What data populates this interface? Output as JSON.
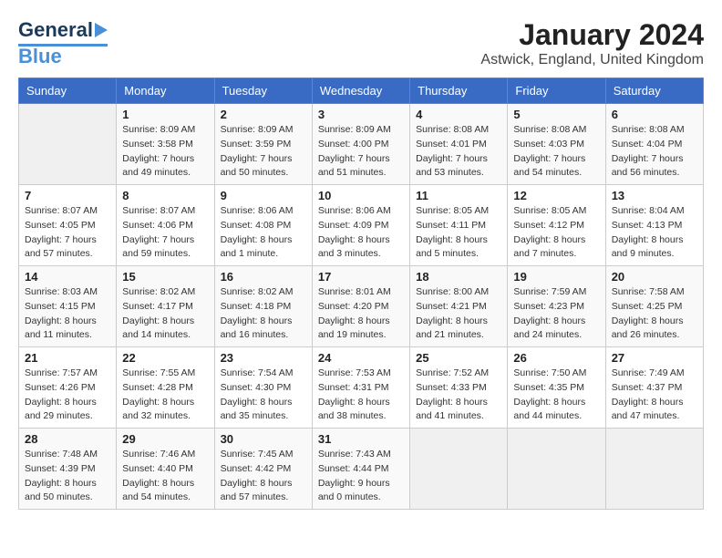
{
  "header": {
    "logo_general": "General",
    "logo_blue": "Blue",
    "month_title": "January 2024",
    "location": "Astwick, England, United Kingdom"
  },
  "days_of_week": [
    "Sunday",
    "Monday",
    "Tuesday",
    "Wednesday",
    "Thursday",
    "Friday",
    "Saturday"
  ],
  "weeks": [
    [
      {
        "day": "",
        "sunrise": "",
        "sunset": "",
        "daylight": "",
        "empty": true
      },
      {
        "day": "1",
        "sunrise": "Sunrise: 8:09 AM",
        "sunset": "Sunset: 3:58 PM",
        "daylight": "Daylight: 7 hours and 49 minutes."
      },
      {
        "day": "2",
        "sunrise": "Sunrise: 8:09 AM",
        "sunset": "Sunset: 3:59 PM",
        "daylight": "Daylight: 7 hours and 50 minutes."
      },
      {
        "day": "3",
        "sunrise": "Sunrise: 8:09 AM",
        "sunset": "Sunset: 4:00 PM",
        "daylight": "Daylight: 7 hours and 51 minutes."
      },
      {
        "day": "4",
        "sunrise": "Sunrise: 8:08 AM",
        "sunset": "Sunset: 4:01 PM",
        "daylight": "Daylight: 7 hours and 53 minutes."
      },
      {
        "day": "5",
        "sunrise": "Sunrise: 8:08 AM",
        "sunset": "Sunset: 4:03 PM",
        "daylight": "Daylight: 7 hours and 54 minutes."
      },
      {
        "day": "6",
        "sunrise": "Sunrise: 8:08 AM",
        "sunset": "Sunset: 4:04 PM",
        "daylight": "Daylight: 7 hours and 56 minutes."
      }
    ],
    [
      {
        "day": "7",
        "sunrise": "Sunrise: 8:07 AM",
        "sunset": "Sunset: 4:05 PM",
        "daylight": "Daylight: 7 hours and 57 minutes."
      },
      {
        "day": "8",
        "sunrise": "Sunrise: 8:07 AM",
        "sunset": "Sunset: 4:06 PM",
        "daylight": "Daylight: 7 hours and 59 minutes."
      },
      {
        "day": "9",
        "sunrise": "Sunrise: 8:06 AM",
        "sunset": "Sunset: 4:08 PM",
        "daylight": "Daylight: 8 hours and 1 minute."
      },
      {
        "day": "10",
        "sunrise": "Sunrise: 8:06 AM",
        "sunset": "Sunset: 4:09 PM",
        "daylight": "Daylight: 8 hours and 3 minutes."
      },
      {
        "day": "11",
        "sunrise": "Sunrise: 8:05 AM",
        "sunset": "Sunset: 4:11 PM",
        "daylight": "Daylight: 8 hours and 5 minutes."
      },
      {
        "day": "12",
        "sunrise": "Sunrise: 8:05 AM",
        "sunset": "Sunset: 4:12 PM",
        "daylight": "Daylight: 8 hours and 7 minutes."
      },
      {
        "day": "13",
        "sunrise": "Sunrise: 8:04 AM",
        "sunset": "Sunset: 4:13 PM",
        "daylight": "Daylight: 8 hours and 9 minutes."
      }
    ],
    [
      {
        "day": "14",
        "sunrise": "Sunrise: 8:03 AM",
        "sunset": "Sunset: 4:15 PM",
        "daylight": "Daylight: 8 hours and 11 minutes."
      },
      {
        "day": "15",
        "sunrise": "Sunrise: 8:02 AM",
        "sunset": "Sunset: 4:17 PM",
        "daylight": "Daylight: 8 hours and 14 minutes."
      },
      {
        "day": "16",
        "sunrise": "Sunrise: 8:02 AM",
        "sunset": "Sunset: 4:18 PM",
        "daylight": "Daylight: 8 hours and 16 minutes."
      },
      {
        "day": "17",
        "sunrise": "Sunrise: 8:01 AM",
        "sunset": "Sunset: 4:20 PM",
        "daylight": "Daylight: 8 hours and 19 minutes."
      },
      {
        "day": "18",
        "sunrise": "Sunrise: 8:00 AM",
        "sunset": "Sunset: 4:21 PM",
        "daylight": "Daylight: 8 hours and 21 minutes."
      },
      {
        "day": "19",
        "sunrise": "Sunrise: 7:59 AM",
        "sunset": "Sunset: 4:23 PM",
        "daylight": "Daylight: 8 hours and 24 minutes."
      },
      {
        "day": "20",
        "sunrise": "Sunrise: 7:58 AM",
        "sunset": "Sunset: 4:25 PM",
        "daylight": "Daylight: 8 hours and 26 minutes."
      }
    ],
    [
      {
        "day": "21",
        "sunrise": "Sunrise: 7:57 AM",
        "sunset": "Sunset: 4:26 PM",
        "daylight": "Daylight: 8 hours and 29 minutes."
      },
      {
        "day": "22",
        "sunrise": "Sunrise: 7:55 AM",
        "sunset": "Sunset: 4:28 PM",
        "daylight": "Daylight: 8 hours and 32 minutes."
      },
      {
        "day": "23",
        "sunrise": "Sunrise: 7:54 AM",
        "sunset": "Sunset: 4:30 PM",
        "daylight": "Daylight: 8 hours and 35 minutes."
      },
      {
        "day": "24",
        "sunrise": "Sunrise: 7:53 AM",
        "sunset": "Sunset: 4:31 PM",
        "daylight": "Daylight: 8 hours and 38 minutes."
      },
      {
        "day": "25",
        "sunrise": "Sunrise: 7:52 AM",
        "sunset": "Sunset: 4:33 PM",
        "daylight": "Daylight: 8 hours and 41 minutes."
      },
      {
        "day": "26",
        "sunrise": "Sunrise: 7:50 AM",
        "sunset": "Sunset: 4:35 PM",
        "daylight": "Daylight: 8 hours and 44 minutes."
      },
      {
        "day": "27",
        "sunrise": "Sunrise: 7:49 AM",
        "sunset": "Sunset: 4:37 PM",
        "daylight": "Daylight: 8 hours and 47 minutes."
      }
    ],
    [
      {
        "day": "28",
        "sunrise": "Sunrise: 7:48 AM",
        "sunset": "Sunset: 4:39 PM",
        "daylight": "Daylight: 8 hours and 50 minutes."
      },
      {
        "day": "29",
        "sunrise": "Sunrise: 7:46 AM",
        "sunset": "Sunset: 4:40 PM",
        "daylight": "Daylight: 8 hours and 54 minutes."
      },
      {
        "day": "30",
        "sunrise": "Sunrise: 7:45 AM",
        "sunset": "Sunset: 4:42 PM",
        "daylight": "Daylight: 8 hours and 57 minutes."
      },
      {
        "day": "31",
        "sunrise": "Sunrise: 7:43 AM",
        "sunset": "Sunset: 4:44 PM",
        "daylight": "Daylight: 9 hours and 0 minutes."
      },
      {
        "day": "",
        "sunrise": "",
        "sunset": "",
        "daylight": "",
        "empty": true
      },
      {
        "day": "",
        "sunrise": "",
        "sunset": "",
        "daylight": "",
        "empty": true
      },
      {
        "day": "",
        "sunrise": "",
        "sunset": "",
        "daylight": "",
        "empty": true
      }
    ]
  ]
}
